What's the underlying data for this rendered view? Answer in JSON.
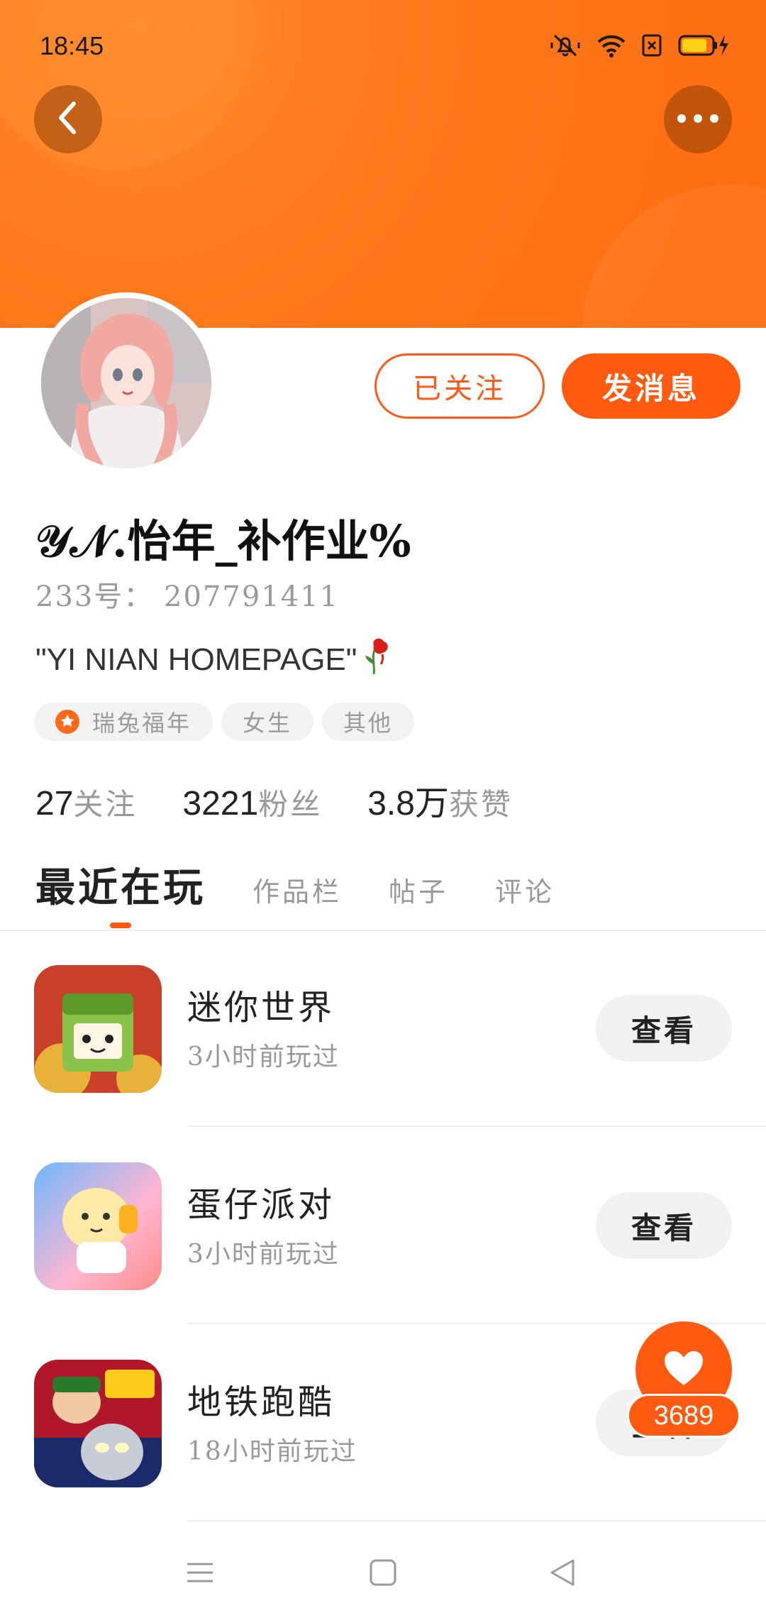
{
  "status_bar": {
    "time": "18:45"
  },
  "header": {
    "back_icon": "chevron-left-icon",
    "more_icon": "more-horizontal-icon"
  },
  "profile": {
    "follow_button": "已关注",
    "message_button": "发消息",
    "username": "𝒴𝒩.怡年_补作业%",
    "user_id": "233号：  207791411",
    "bio": "\"YI NIAN HOMEPAGE\"",
    "tags": [
      "瑞兔福年",
      "女生",
      "其他"
    ],
    "stats": [
      {
        "num": "27",
        "label": "关注"
      },
      {
        "num": "3221",
        "label": "粉丝"
      },
      {
        "num": "3.8万",
        "label": "获赞"
      }
    ]
  },
  "tabs": [
    "最近在玩",
    "作品栏",
    "帖子",
    "评论"
  ],
  "games": [
    {
      "name": "迷你世界",
      "time": "3小时前玩过",
      "button": "查看"
    },
    {
      "name": "蛋仔派对",
      "time": "3小时前玩过",
      "button": "查看"
    },
    {
      "name": "地铁跑酷",
      "time": "18小时前玩过",
      "button": "查看"
    }
  ],
  "like_fab": {
    "count": "3689",
    "icon": "heart-icon"
  },
  "colors": {
    "accent": "#ff5a0f",
    "header": "#ff7a1c"
  }
}
